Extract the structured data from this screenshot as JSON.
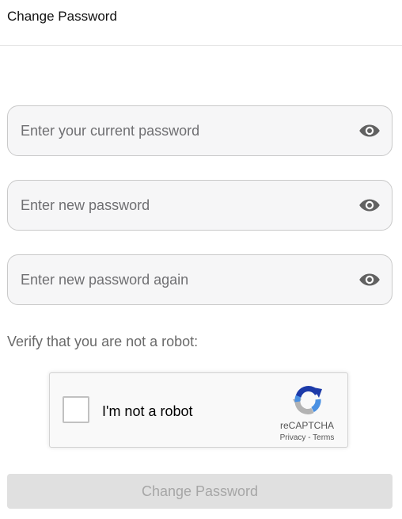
{
  "header": {
    "title": "Change Password"
  },
  "form": {
    "fields": [
      {
        "placeholder": "Enter your current password",
        "value": "",
        "icon": "eye-icon"
      },
      {
        "placeholder": "Enter new password",
        "value": "",
        "icon": "eye-icon"
      },
      {
        "placeholder": "Enter new password again",
        "value": "",
        "icon": "eye-icon"
      }
    ],
    "verify_label": "Verify that you are not a robot:",
    "captcha": {
      "checkbox_label": "I'm not a robot",
      "brand": "reCAPTCHA",
      "privacy_link": "Privacy",
      "separator": " - ",
      "terms_link": "Terms",
      "checked": false
    },
    "submit_label": "Change Password",
    "submit_disabled": true
  },
  "colors": {
    "field_background": "#f6f6f7",
    "field_border": "#c9c9c9",
    "icon_color": "#616161",
    "button_disabled_background": "#e0e0e0",
    "button_disabled_text": "#a6a6a6",
    "recaptcha_blue": "#1c3aa9",
    "recaptcha_light_blue": "#4a90e2",
    "recaptcha_gray": "#b3b3b3"
  }
}
